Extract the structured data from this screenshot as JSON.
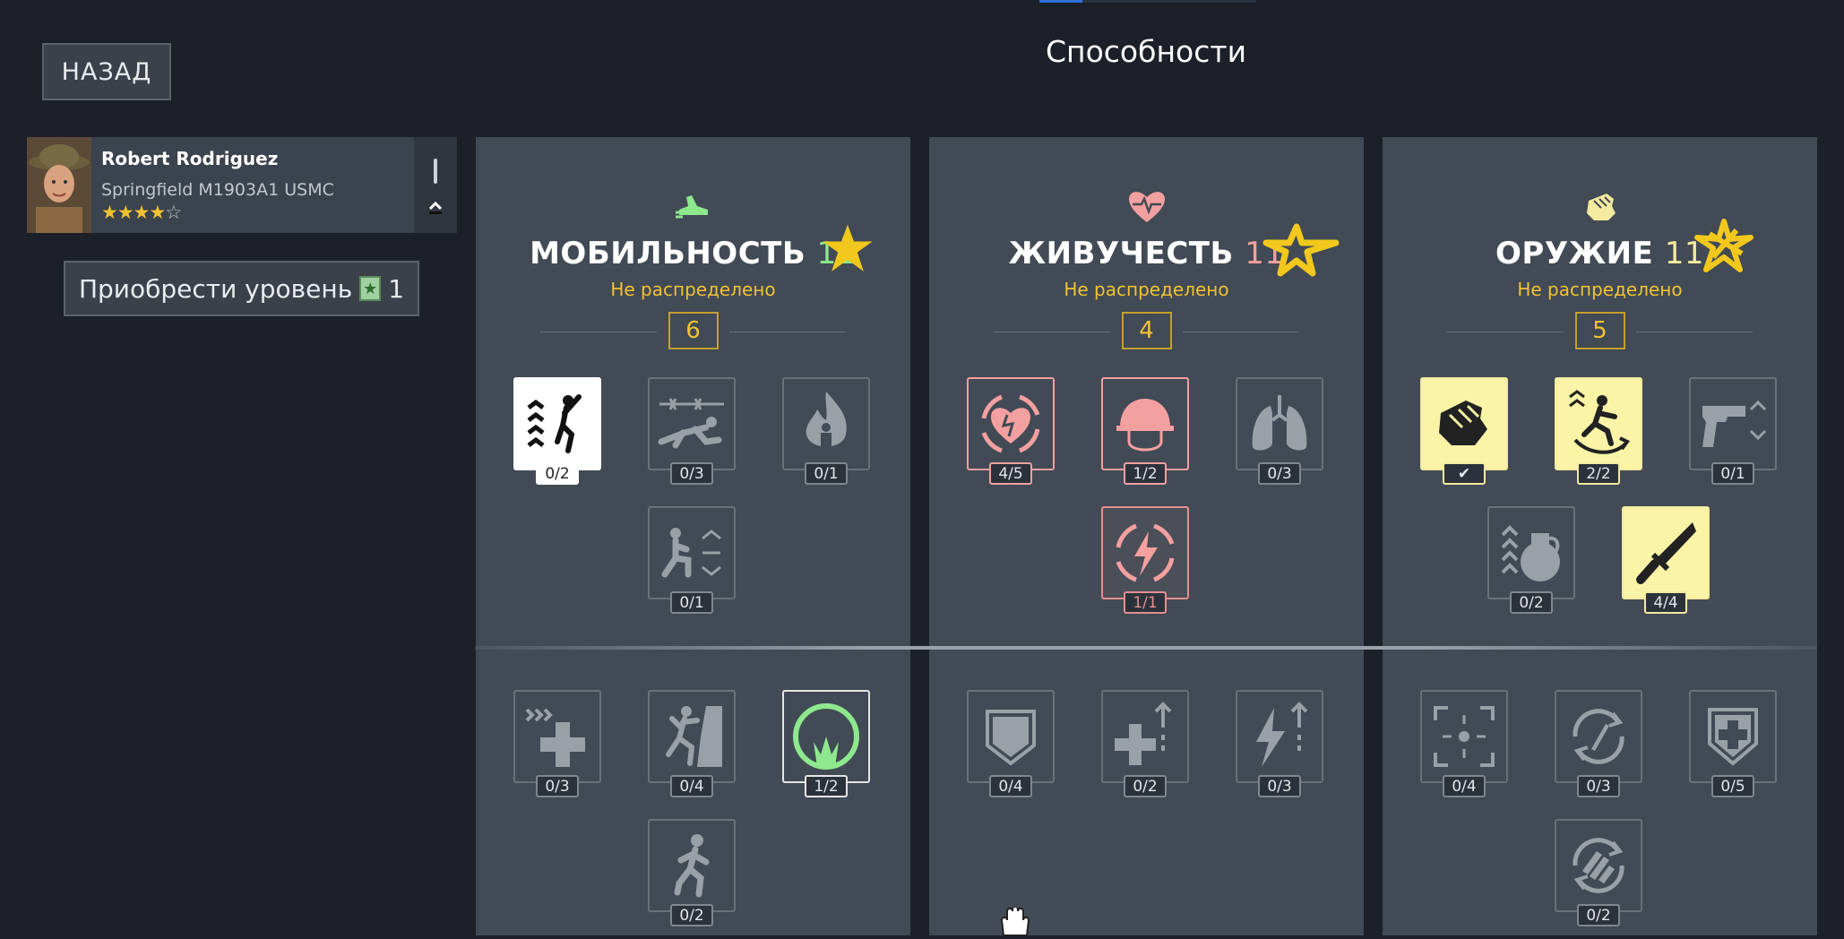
{
  "header": {
    "back_label": "НАЗАД",
    "title": "Способности"
  },
  "soldier": {
    "name": "Robert Rodriguez",
    "weapon": "Springfield M1903A1 USMC",
    "stars_filled": 4,
    "stars_total": 5
  },
  "buy_level": {
    "label": "Приобрести уровень",
    "count": "1"
  },
  "columns": [
    {
      "id": "mobility",
      "title": "МОБИЛЬНОСТЬ",
      "level": "11",
      "level_color": "#8ee88e",
      "status": "Не распределено",
      "points": "6",
      "skills": [
        {
          "icon": "jump-boost-icon",
          "progress": "0/2",
          "state": "white"
        },
        {
          "icon": "crawl-under-wire-icon",
          "progress": "0/3",
          "state": "normal"
        },
        {
          "icon": "fire-resist-icon",
          "progress": "0/1",
          "state": "normal"
        },
        {
          "icon": "crouch-stance-icon",
          "progress": "0/1",
          "state": "normal"
        },
        {
          "icon": "fast-heal-icon",
          "progress": "0/3",
          "state": "normal"
        },
        {
          "icon": "climb-icon",
          "progress": "0/4",
          "state": "normal"
        },
        {
          "icon": "grass-stealth-icon",
          "progress": "1/2",
          "state": "green"
        },
        {
          "icon": "sprint-icon",
          "progress": "0/2",
          "state": "normal"
        }
      ]
    },
    {
      "id": "vitality",
      "title": "ЖИВУЧЕСТЬ",
      "level": "11",
      "level_color": "#f3a0a0",
      "status": "Не распределено",
      "points": "4",
      "skills": [
        {
          "icon": "heart-regen-icon",
          "progress": "4/5",
          "state": "pink"
        },
        {
          "icon": "helmet-icon",
          "progress": "1/2",
          "state": "pink"
        },
        {
          "icon": "lungs-icon",
          "progress": "0/3",
          "state": "normal"
        },
        {
          "icon": "stamina-regen-icon",
          "progress": "1/1",
          "state": "pink-dim"
        },
        {
          "icon": "shield-icon",
          "progress": "0/4",
          "state": "normal"
        },
        {
          "icon": "heal-up-icon",
          "progress": "0/2",
          "state": "normal"
        },
        {
          "icon": "energy-up-icon",
          "progress": "0/3",
          "state": "normal"
        }
      ]
    },
    {
      "id": "weapon",
      "title": "ОРУЖИЕ",
      "level": "11",
      "level_color": "#f4eaa0",
      "status": "Не распределено",
      "points": "5",
      "skills": [
        {
          "icon": "fist-icon",
          "progress": "✔",
          "state": "yellow-fill"
        },
        {
          "icon": "dodge-roll-icon",
          "progress": "2/2",
          "state": "yellow"
        },
        {
          "icon": "pistol-swap-icon",
          "progress": "0/1",
          "state": "normal"
        },
        {
          "icon": "grenade-throw-icon",
          "progress": "0/2",
          "state": "normal"
        },
        {
          "icon": "knife-icon",
          "progress": "4/4",
          "state": "yellow-fill"
        },
        {
          "icon": "aim-focus-icon",
          "progress": "0/4",
          "state": "normal"
        },
        {
          "icon": "reload-icon",
          "progress": "0/3",
          "state": "normal"
        },
        {
          "icon": "armor-plus-icon",
          "progress": "0/5",
          "state": "normal"
        },
        {
          "icon": "ammo-reload-icon",
          "progress": "0/2",
          "state": "normal"
        }
      ]
    }
  ]
}
